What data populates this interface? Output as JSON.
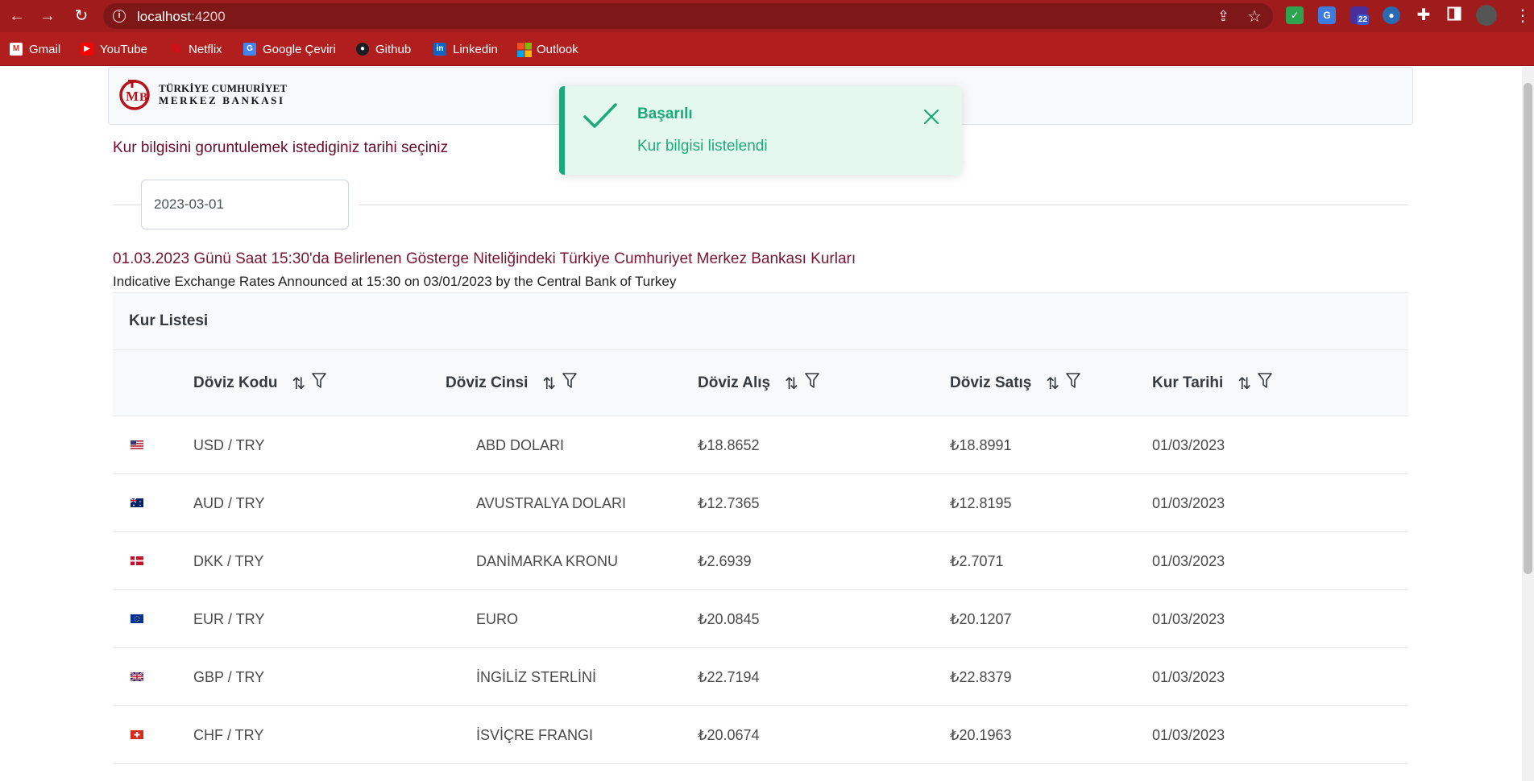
{
  "browser": {
    "url_host": "localhost",
    "url_port": ":4200",
    "extension_badge": "22",
    "bookmarks": [
      {
        "label": "Gmail",
        "icon": "gmail-icon"
      },
      {
        "label": "YouTube",
        "icon": "youtube-icon"
      },
      {
        "label": "Netflix",
        "icon": "netflix-icon"
      },
      {
        "label": "Google Çeviri",
        "icon": "google-translate-icon"
      },
      {
        "label": "Github",
        "icon": "github-icon"
      },
      {
        "label": "Linkedin",
        "icon": "linkedin-icon"
      },
      {
        "label": "Outlook",
        "icon": "outlook-icon"
      }
    ]
  },
  "header": {
    "logo_line1": "TÜRKİYE CUMHURİYET",
    "logo_line2": "MERKEZ BANKASI"
  },
  "form": {
    "prompt": "Kur bilgisini goruntulemek istediginiz tarihi seçiniz",
    "date_value": "2023-03-01"
  },
  "titles": {
    "tr": "01.03.2023 Günü Saat 15:30'da Belirlenen Gösterge Niteliğindeki Türkiye Cumhuriyet Merkez Bankası Kurları",
    "en": "Indicative Exchange Rates Announced at 15:30 on 03/01/2023 by the Central Bank of Turkey"
  },
  "table": {
    "caption": "Kur Listesi",
    "columns": [
      "Döviz Kodu",
      "Döviz Cinsi",
      "Döviz Alış",
      "Döviz Satış",
      "Kur Tarihi"
    ],
    "rows": [
      {
        "flag": "us-flag-icon",
        "code": "USD / TRY",
        "name": "ABD DOLARI",
        "buy": "₺18.8652",
        "sell": "₺18.8991",
        "date": "01/03/2023"
      },
      {
        "flag": "au-flag-icon",
        "code": "AUD / TRY",
        "name": "AVUSTRALYA DOLARI",
        "buy": "₺12.7365",
        "sell": "₺12.8195",
        "date": "01/03/2023"
      },
      {
        "flag": "dk-flag-icon",
        "code": "DKK / TRY",
        "name": "DANİMARKA KRONU",
        "buy": "₺2.6939",
        "sell": "₺2.7071",
        "date": "01/03/2023"
      },
      {
        "flag": "eu-flag-icon",
        "code": "EUR / TRY",
        "name": "EURO",
        "buy": "₺20.0845",
        "sell": "₺20.1207",
        "date": "01/03/2023"
      },
      {
        "flag": "gb-flag-icon",
        "code": "GBP / TRY",
        "name": "İNGİLİZ STERLİNİ",
        "buy": "₺22.7194",
        "sell": "₺22.8379",
        "date": "01/03/2023"
      },
      {
        "flag": "ch-flag-icon",
        "code": "CHF / TRY",
        "name": "İSVİÇRE FRANGI",
        "buy": "₺20.0674",
        "sell": "₺20.1963",
        "date": "01/03/2023"
      }
    ]
  },
  "toast": {
    "title": "Başarılı",
    "detail": "Kur bilgisi listelendi"
  },
  "colors": {
    "browser_frame": "#a01c1c",
    "brand": "#7a1431",
    "success": "#1ea97c",
    "toast_bg": "#e4f8f0"
  }
}
